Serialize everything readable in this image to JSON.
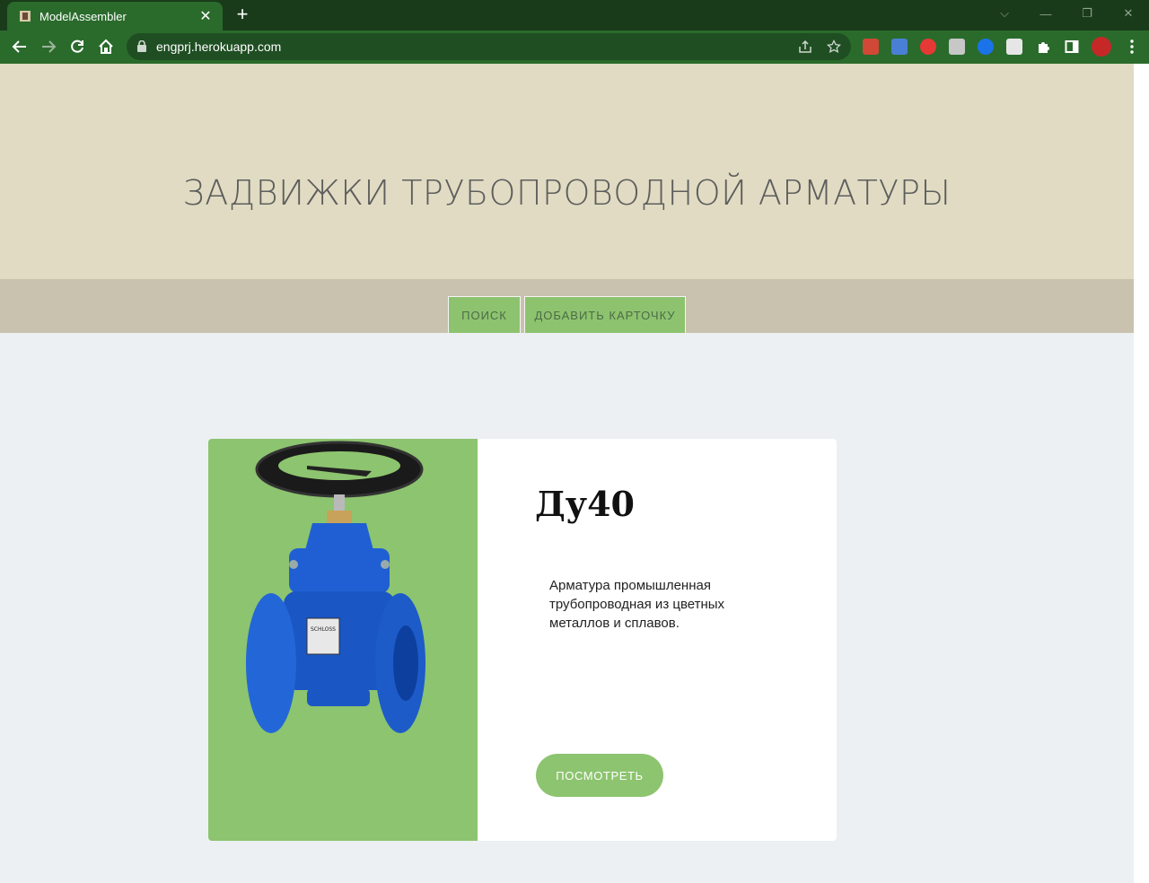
{
  "browser": {
    "tab_title": "ModelAssembler",
    "tab_close": "✕",
    "new_tab": "+",
    "url": "engprj.herokuapp.com",
    "window_controls": {
      "dropdown": "⌵",
      "minimize": "—",
      "restore": "❐",
      "close": "✕"
    }
  },
  "hero": {
    "title": "ЗАДВИЖКИ ТРУБОПРОВОДНОЙ АРМАТУРЫ"
  },
  "nav": {
    "search_label": "ПОИСК",
    "add_card_label": "ДОБАВИТЬ КАРТОЧКУ"
  },
  "card": {
    "title": "Ду40",
    "description": "Арматура промышленная трубопроводная из цветных металлов и сплавов.",
    "button_label": "ПОСМОТРЕТЬ",
    "image": "gate-valve-image",
    "plate_text": "SCHLOSS"
  },
  "colors": {
    "tabbar": "#1a3b1a",
    "toolbar": "#2a6b2c",
    "hero_bg": "#e0dbc2",
    "nav_bg": "#c9c2af",
    "accent_green": "#8dc46f",
    "page_bg": "#ecf0f3",
    "valve_blue": "#1f5fd3"
  }
}
